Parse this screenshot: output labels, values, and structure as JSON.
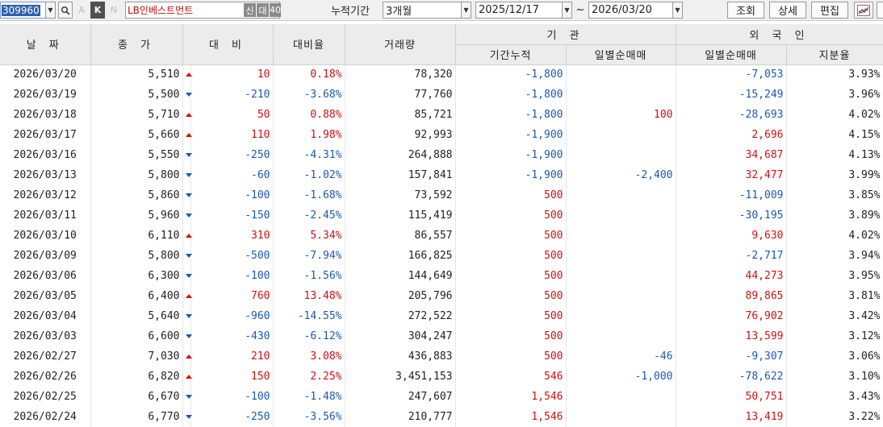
{
  "toolbar": {
    "code": "309960",
    "a_label": "A",
    "k_label": "K",
    "n_label": "N",
    "stock_name": "LB인베스트먼트",
    "tag1": "신",
    "tag2": "대",
    "tag3": "40",
    "period_label": "누적기간",
    "period_value": "3개월",
    "start_date": "2025/12/17",
    "tilde": "~",
    "end_date": "2026/03/20",
    "search_btn": "조회",
    "detail_btn": "상세",
    "edit_btn": "편집"
  },
  "headers": {
    "date": "날 짜",
    "close": "종 가",
    "change": "대 비",
    "rate": "대비율",
    "volume": "거래량",
    "inst_group": "기 관",
    "inst_cum": "기간누적",
    "inst_daily": "일별순매매",
    "foreign_group": "외 국 인",
    "foreign_daily": "일별순매매",
    "foreign_share": "지분율"
  },
  "rows": [
    {
      "date": "2026/03/20",
      "close": "5,510",
      "dir": "up",
      "change": "10",
      "rate": "0.18%",
      "volume": "78,320",
      "inst_cum": "-1,800",
      "inst_daily": "",
      "foreign_daily": "-7,053",
      "share": "3.93%"
    },
    {
      "date": "2026/03/19",
      "close": "5,500",
      "dir": "down",
      "change": "-210",
      "rate": "-3.68%",
      "volume": "77,760",
      "inst_cum": "-1,800",
      "inst_daily": "",
      "foreign_daily": "-15,249",
      "share": "3.96%"
    },
    {
      "date": "2026/03/18",
      "close": "5,710",
      "dir": "up",
      "change": "50",
      "rate": "0.88%",
      "volume": "85,721",
      "inst_cum": "-1,800",
      "inst_daily": "100",
      "foreign_daily": "-28,693",
      "share": "4.02%"
    },
    {
      "date": "2026/03/17",
      "close": "5,660",
      "dir": "up",
      "change": "110",
      "rate": "1.98%",
      "volume": "92,993",
      "inst_cum": "-1,900",
      "inst_daily": "",
      "foreign_daily": "2,696",
      "share": "4.15%"
    },
    {
      "date": "2026/03/16",
      "close": "5,550",
      "dir": "down",
      "change": "-250",
      "rate": "-4.31%",
      "volume": "264,888",
      "inst_cum": "-1,900",
      "inst_daily": "",
      "foreign_daily": "34,687",
      "share": "4.13%"
    },
    {
      "date": "2026/03/13",
      "close": "5,800",
      "dir": "down",
      "change": "-60",
      "rate": "-1.02%",
      "volume": "157,841",
      "inst_cum": "-1,900",
      "inst_daily": "-2,400",
      "foreign_daily": "32,477",
      "share": "3.99%"
    },
    {
      "date": "2026/03/12",
      "close": "5,860",
      "dir": "down",
      "change": "-100",
      "rate": "-1.68%",
      "volume": "73,592",
      "inst_cum": "500",
      "inst_daily": "",
      "foreign_daily": "-11,009",
      "share": "3.85%"
    },
    {
      "date": "2026/03/11",
      "close": "5,960",
      "dir": "down",
      "change": "-150",
      "rate": "-2.45%",
      "volume": "115,419",
      "inst_cum": "500",
      "inst_daily": "",
      "foreign_daily": "-30,195",
      "share": "3.89%"
    },
    {
      "date": "2026/03/10",
      "close": "6,110",
      "dir": "up",
      "change": "310",
      "rate": "5.34%",
      "volume": "86,557",
      "inst_cum": "500",
      "inst_daily": "",
      "foreign_daily": "9,630",
      "share": "4.02%"
    },
    {
      "date": "2026/03/09",
      "close": "5,800",
      "dir": "down",
      "change": "-500",
      "rate": "-7.94%",
      "volume": "166,825",
      "inst_cum": "500",
      "inst_daily": "",
      "foreign_daily": "-2,717",
      "share": "3.94%"
    },
    {
      "date": "2026/03/06",
      "close": "6,300",
      "dir": "down",
      "change": "-100",
      "rate": "-1.56%",
      "volume": "144,649",
      "inst_cum": "500",
      "inst_daily": "",
      "foreign_daily": "44,273",
      "share": "3.95%"
    },
    {
      "date": "2026/03/05",
      "close": "6,400",
      "dir": "up",
      "change": "760",
      "rate": "13.48%",
      "volume": "205,796",
      "inst_cum": "500",
      "inst_daily": "",
      "foreign_daily": "89,865",
      "share": "3.81%"
    },
    {
      "date": "2026/03/04",
      "close": "5,640",
      "dir": "down",
      "change": "-960",
      "rate": "-14.55%",
      "volume": "272,522",
      "inst_cum": "500",
      "inst_daily": "",
      "foreign_daily": "76,902",
      "share": "3.42%"
    },
    {
      "date": "2026/03/03",
      "close": "6,600",
      "dir": "down",
      "change": "-430",
      "rate": "-6.12%",
      "volume": "304,247",
      "inst_cum": "500",
      "inst_daily": "",
      "foreign_daily": "13,599",
      "share": "3.12%"
    },
    {
      "date": "2026/02/27",
      "close": "7,030",
      "dir": "up",
      "change": "210",
      "rate": "3.08%",
      "volume": "436,883",
      "inst_cum": "500",
      "inst_daily": "-46",
      "foreign_daily": "-9,307",
      "share": "3.06%"
    },
    {
      "date": "2026/02/26",
      "close": "6,820",
      "dir": "up",
      "change": "150",
      "rate": "2.25%",
      "volume": "3,451,153",
      "inst_cum": "546",
      "inst_daily": "-1,000",
      "foreign_daily": "-78,622",
      "share": "3.10%"
    },
    {
      "date": "2026/02/25",
      "close": "6,670",
      "dir": "down",
      "change": "-100",
      "rate": "-1.48%",
      "volume": "247,607",
      "inst_cum": "1,546",
      "inst_daily": "",
      "foreign_daily": "50,751",
      "share": "3.43%"
    },
    {
      "date": "2026/02/24",
      "close": "6,770",
      "dir": "down",
      "change": "-250",
      "rate": "-3.56%",
      "volume": "210,777",
      "inst_cum": "1,546",
      "inst_daily": "",
      "foreign_daily": "13,419",
      "share": "3.22%"
    }
  ],
  "colors": {
    "up": "#d01010",
    "down": "#1a58b8"
  },
  "icons": {
    "search": "search-icon",
    "chart": "chart-icon"
  }
}
